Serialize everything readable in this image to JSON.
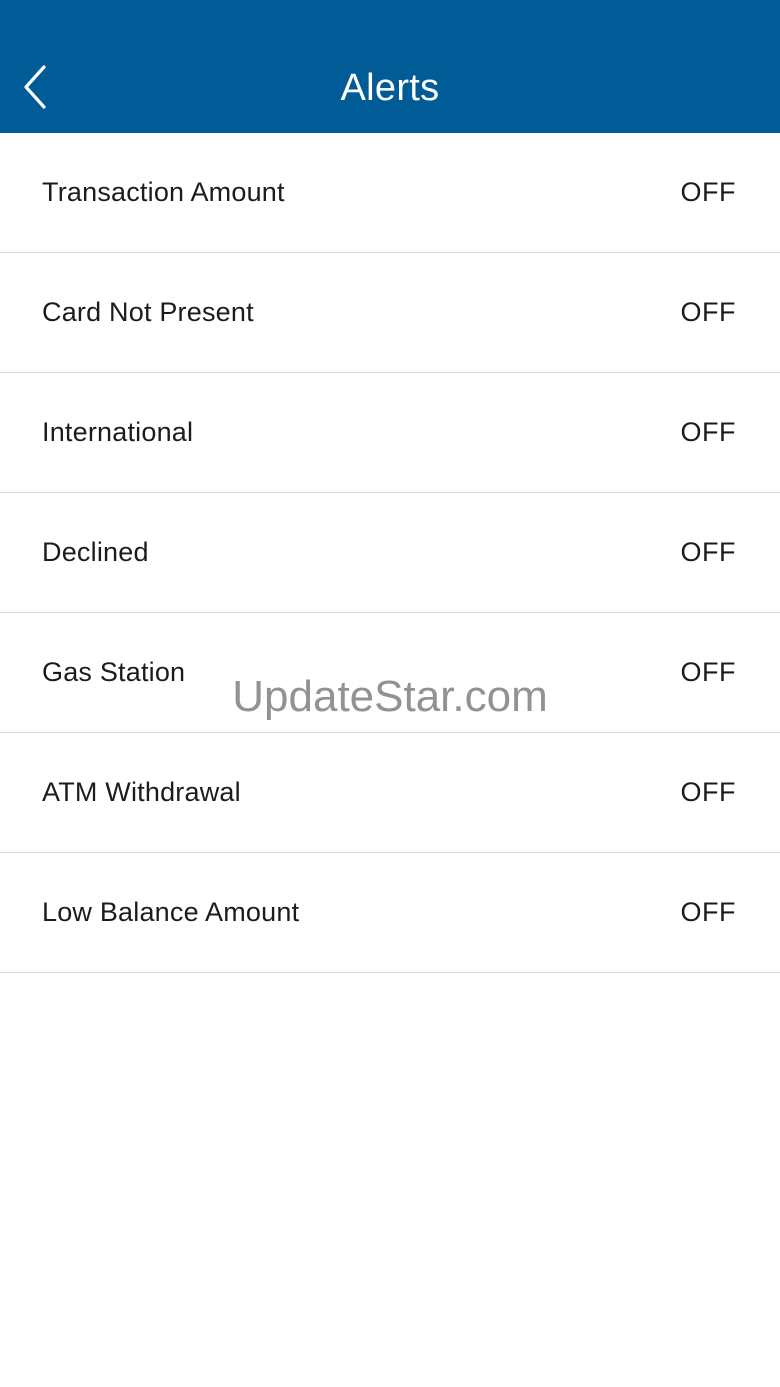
{
  "header": {
    "title": "Alerts",
    "back_icon": "chevron-left-icon",
    "background_color": "#005b96",
    "text_color": "#ffffff"
  },
  "alerts": [
    {
      "label": "Transaction Amount",
      "status": "OFF"
    },
    {
      "label": "Card Not Present",
      "status": "OFF"
    },
    {
      "label": "International",
      "status": "OFF"
    },
    {
      "label": "Declined",
      "status": "OFF"
    },
    {
      "label": "Gas Station",
      "status": "OFF"
    },
    {
      "label": "ATM Withdrawal",
      "status": "OFF"
    },
    {
      "label": "Low Balance Amount",
      "status": "OFF"
    }
  ],
  "watermark": {
    "text": "UpdateStar.com"
  }
}
